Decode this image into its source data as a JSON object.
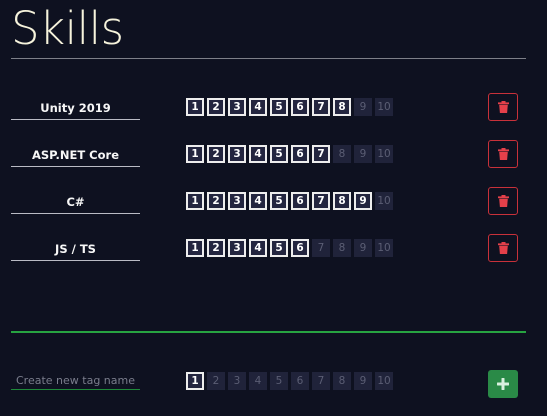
{
  "page": {
    "title": "Skills"
  },
  "skills": [
    {
      "name": "Unity 2019",
      "level": 8
    },
    {
      "name": "ASP.NET Core",
      "level": 7
    },
    {
      "name": "C#",
      "level": 9
    },
    {
      "name": "JS / TS",
      "level": 6
    }
  ],
  "level_labels": [
    "1",
    "2",
    "3",
    "4",
    "5",
    "6",
    "7",
    "8",
    "9",
    "10"
  ],
  "new_tag": {
    "placeholder": "Create new tag name",
    "value": "",
    "level": 1
  },
  "icons": {
    "delete": "trash-icon",
    "add": "plus-icon"
  },
  "colors": {
    "background": "#0e1120",
    "title": "#f6f3dc",
    "delete_accent": "#c8313a",
    "add_accent": "#2a8a47",
    "divider_green": "#27a341"
  }
}
